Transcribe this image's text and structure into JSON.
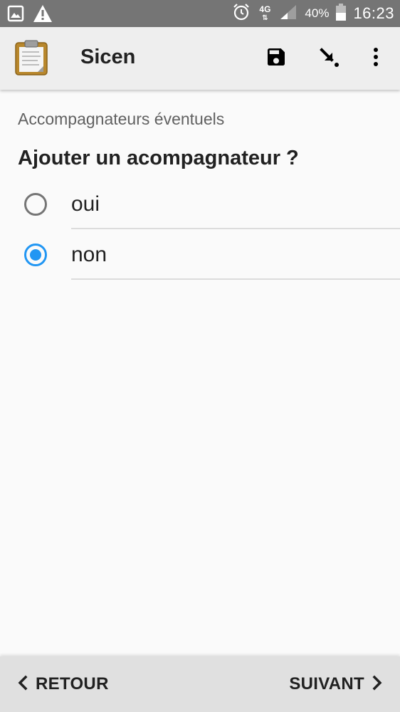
{
  "status_bar": {
    "network": "4G",
    "battery": "40%",
    "time": "16:23",
    "icons": [
      "image-icon",
      "warning-icon",
      "alarm-icon",
      "signal-icon",
      "battery-icon"
    ]
  },
  "toolbar": {
    "title": "Sicen",
    "icons": [
      "clipboard-icon",
      "save-icon",
      "goto-icon",
      "more-vert-icon"
    ]
  },
  "form": {
    "group_label": "Accompagnateurs éventuels",
    "question": "Ajouter un acompagnateur ?",
    "options": [
      {
        "label": "oui",
        "selected": false
      },
      {
        "label": "non",
        "selected": true
      }
    ]
  },
  "navigation": {
    "back_label": "RETOUR",
    "next_label": "SUIVANT"
  },
  "colors": {
    "status_bar": "#757575",
    "app_bar": "#eeeeee",
    "accent": "#2196f3",
    "background": "#fafafa",
    "bottom_bar": "#e0e0e0"
  }
}
